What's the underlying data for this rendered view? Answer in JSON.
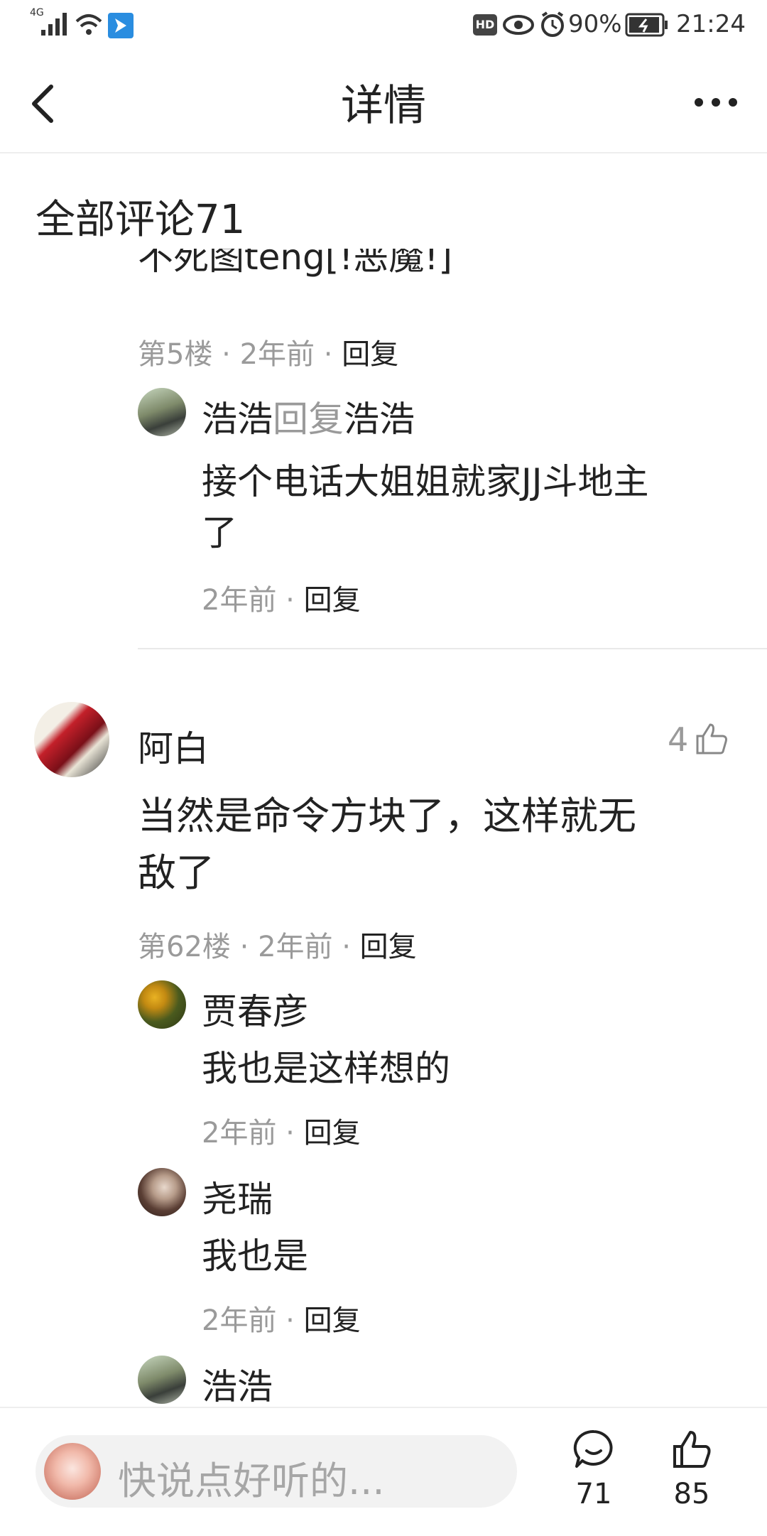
{
  "status_bar": {
    "network": "4G",
    "battery": "90%",
    "time": "21:24",
    "hd_badge": "HD",
    "icons": [
      "signal-icon",
      "wifi-icon",
      "app-notification-icon",
      "eye-icon",
      "alarm-icon",
      "battery-icon"
    ]
  },
  "header": {
    "title": "详情",
    "back_icon": "chevron-left-icon",
    "more_icon": "more-dots-icon"
  },
  "comments_header": "全部评论71",
  "partial_comment": {
    "text_fragment": "不死图teng[!恶魔!]",
    "floor": "第5楼",
    "sep1": "·",
    "time": "2年前",
    "sep2": "·",
    "reply": "回复"
  },
  "reply_a": {
    "user": "浩浩",
    "reply_word": "回复",
    "target": "浩浩",
    "text_line1": "接个电话大姐姐就家JJ斗地主",
    "text_line2": "了",
    "time": "2年前",
    "sep": "·",
    "reply": "回复"
  },
  "main_comment": {
    "user": "阿白",
    "likes": "4",
    "text_line1": "当然是命令方块了，这样就无",
    "text_line2": "敌了",
    "floor": "第62楼",
    "sep1": "·",
    "time": "2年前",
    "sep2": "·",
    "reply": "回复"
  },
  "replies": [
    {
      "user": "贾春彦",
      "text": "我也是这样想的",
      "time": "2年前",
      "sep": "·",
      "reply": "回复"
    },
    {
      "user": "尧瑞",
      "text": "我也是",
      "time": "2年前",
      "sep": "·",
      "reply": "回复"
    },
    {
      "user": "浩浩"
    }
  ],
  "bottom_bar": {
    "placeholder": "快说点好听的...",
    "comment_count": "71",
    "like_count": "85"
  },
  "colors": {
    "text_primary": "#222222",
    "text_secondary": "#9a9a9a",
    "divider": "#e9e9e9",
    "input_bg": "#f2f2f2"
  }
}
